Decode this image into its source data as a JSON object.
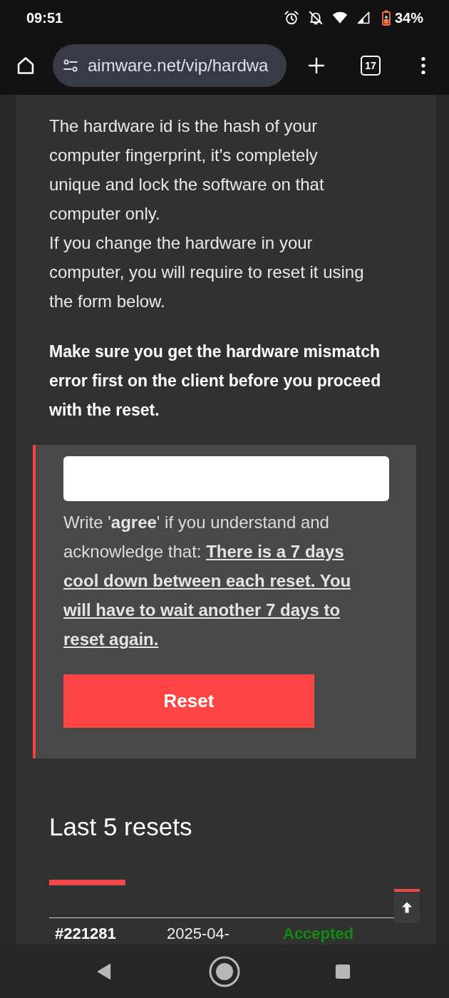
{
  "status_bar": {
    "time": "09:51",
    "battery": "34%"
  },
  "browser": {
    "url": "aimware.net/vip/hardwa",
    "tab_count": "17"
  },
  "intro": [
    "The hardware id is the hash of your computer fingerprint, it's completely unique and lock the software on that computer only.",
    "If you change the hardware in your computer, you will require to reset it using the form below."
  ],
  "warning": "Make sure you get the hardware mismatch error first on the client before you proceed with the reset.",
  "reset_form": {
    "instruction": "Write '**agree**' if you understand and acknowledge that:",
    "condition": "There is a 7 days cool down between each reset. You will have to wait another 7 days to reset again.",
    "button": "Reset"
  },
  "resets": {
    "title": "Last 5 resets",
    "rows": [
      {
        "id": "#221281",
        "date": "2025-04-",
        "status": "Accepted",
        "color": "#138a13"
      }
    ]
  }
}
